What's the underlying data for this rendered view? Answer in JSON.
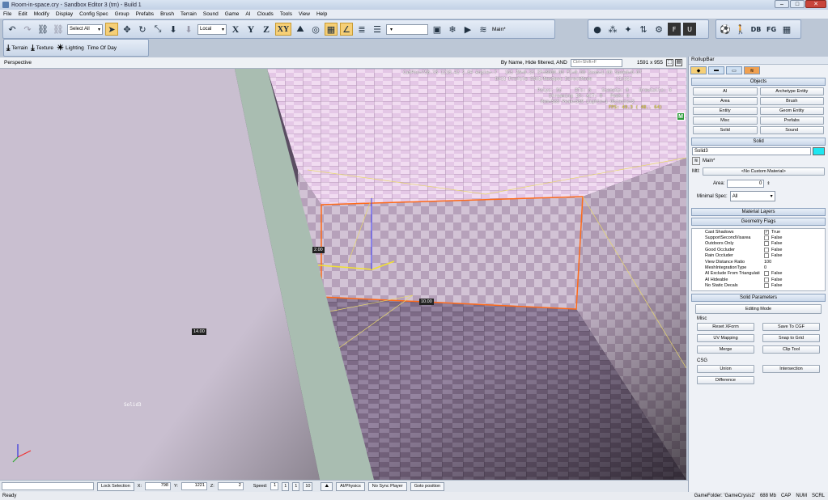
{
  "window": {
    "title": "Room-in-space.cry - Sandbox Editor 3 (tm) - Build 1"
  },
  "menu": [
    "File",
    "Edit",
    "Modify",
    "Display",
    "Config Spec",
    "Group",
    "Prefabs",
    "Brush",
    "Terrain",
    "Sound",
    "Game",
    "AI",
    "Clouds",
    "Tools",
    "View",
    "Help"
  ],
  "toolbar": {
    "select_all": "Select All",
    "coord_system": "Local",
    "axis_x": "X",
    "axis_y": "Y",
    "axis_z": "Z",
    "axis_xy": "XY",
    "layer": "Main*"
  },
  "toolbar_right": {
    "db": "DB",
    "fg": "FG",
    "f": "F",
    "u": "U"
  },
  "toolbar2": {
    "terrain": "Terrain",
    "texture": "Texture",
    "lighting": "Lighting",
    "time_of_day": "Time Of Day"
  },
  "viewport": {
    "label": "Perspective",
    "filter": "By Name, Hide filtered, AND",
    "search_placeholder": "Ctrl+Shift+F",
    "resolution": "1591 x 955",
    "info_line": "CamPos=758.78 1218.42 2.84 Angle=-7   165 ZN=0.25 ZF=8000.00 FC=0.00 Zoom=1.00 Speed=0.07",
    "info_line2": "DX11 Profile SSGI/NewSpec DirectMode         [1/21]",
    "stats": "Polys: 56     RTs: 8    SceneCp: 8    DrawCalls: 4",
    "stats2": "Streaming IO: ACT: 0   Peak: 0",
    "stats3": "Mem=565 Peak=589 Lights=1 Objects=2",
    "fps": "FPS: 49.3 ( 48.. 64)",
    "dim_a": "2.00",
    "dim_b": "10.00",
    "dim_c": "14.00",
    "object_label": "Solid3",
    "badge": "M"
  },
  "rollup": {
    "title": "RollupBar",
    "objects_header": "Objects",
    "object_types": [
      "AI",
      "Archetype Entity",
      "Area",
      "Brush",
      "Entity",
      "Geom Entity",
      "Misc",
      "Prefabs",
      "Solid",
      "Sound"
    ],
    "solid_header": "Solid",
    "name_value": "Solid3",
    "color": "#1ee6f0",
    "layer_value": "Main*",
    "mtl_label": "Mtl:",
    "mtl_value": "<No Custom Material>",
    "area_label": "Area:",
    "area_value": "0",
    "min_spec_label": "Minimal Spec:",
    "min_spec_value": "All",
    "material_layers": "Material Layers",
    "geometry_flags": "Geometry Flags",
    "flags": [
      {
        "name": "Cast Shadows",
        "checked": true,
        "value": "True"
      },
      {
        "name": "SupportSecondVisarea",
        "checked": false,
        "value": "False"
      },
      {
        "name": "Outdoors Only",
        "checked": false,
        "value": "False"
      },
      {
        "name": "Good Occluder",
        "checked": false,
        "value": "False"
      },
      {
        "name": "Rain Occluder",
        "checked": false,
        "value": "False"
      },
      {
        "name": "View Distance Ratio",
        "checked": null,
        "value": "100"
      },
      {
        "name": "MeshIntegrationType",
        "checked": null,
        "value": "0"
      },
      {
        "name": "AI Exclude From Triangulati",
        "checked": false,
        "value": "False"
      },
      {
        "name": "AI Hideable",
        "checked": false,
        "value": "False"
      },
      {
        "name": "No Static Decals",
        "checked": false,
        "value": "False"
      }
    ],
    "solid_params": "Solid Parameters",
    "editing_mode": "Editing Mode",
    "misc_label": "Misc",
    "reset_xform": "Reset XForm",
    "save_cgf": "Save To CGF",
    "uv_mapping": "UV Mapping",
    "snap_grid": "Snap to Grid",
    "merge": "Merge",
    "clip_tool": "Clip Tool",
    "csg_label": "CSG",
    "union": "Union",
    "intersection": "Intersection",
    "difference": "Difference"
  },
  "status": {
    "lock_selection": "Lock Selection",
    "x_label": "X:",
    "x_value": "798",
    "y_label": "Y:",
    "y_value": "1221",
    "z_label": "Z:",
    "z_value": "2",
    "speed_label": "Speed:",
    "speed_value": "1",
    "speed_opts": [
      "1",
      "1",
      "10"
    ],
    "ai_physics": "AI/Physics",
    "no_sync": "No Sync Player",
    "goto": "Goto position",
    "ready": "Ready",
    "game_folder": "GameFolder: 'GameCrysis2'",
    "mem": "688 Mb",
    "cap": "CAP",
    "num": "NUM",
    "scrl": "SCRL"
  }
}
